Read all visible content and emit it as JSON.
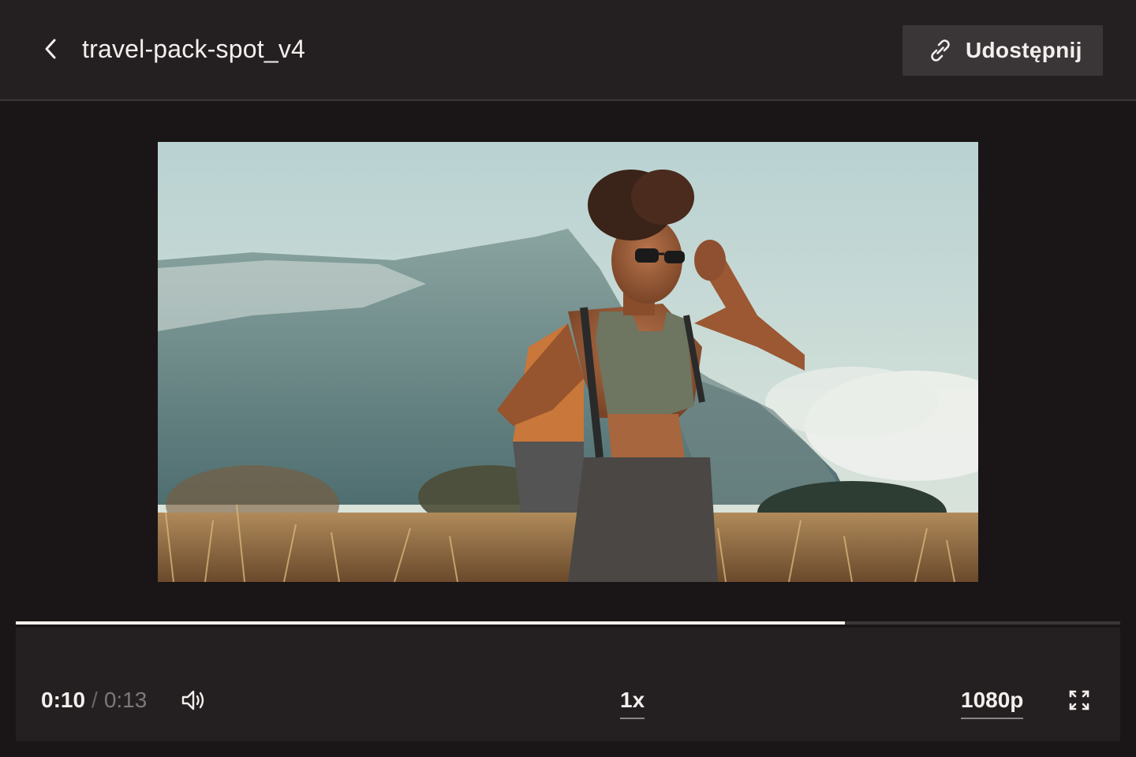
{
  "header": {
    "title": "travel-pack-spot_v4",
    "share_label": "Udostępnij"
  },
  "player": {
    "current_time": "0:10",
    "separator": "/",
    "total_time": "0:13",
    "progress_fraction": 0.751,
    "speed": "1x",
    "quality": "1080p"
  },
  "icons": {
    "back": "chevron-left-icon",
    "share": "link-icon",
    "volume": "volume-icon",
    "fullscreen": "fullscreen-icon"
  },
  "colors": {
    "background": "#1a1617",
    "bar": "#242021",
    "button": "#3a3637",
    "text": "#f2efed",
    "muted": "#7d7778"
  }
}
